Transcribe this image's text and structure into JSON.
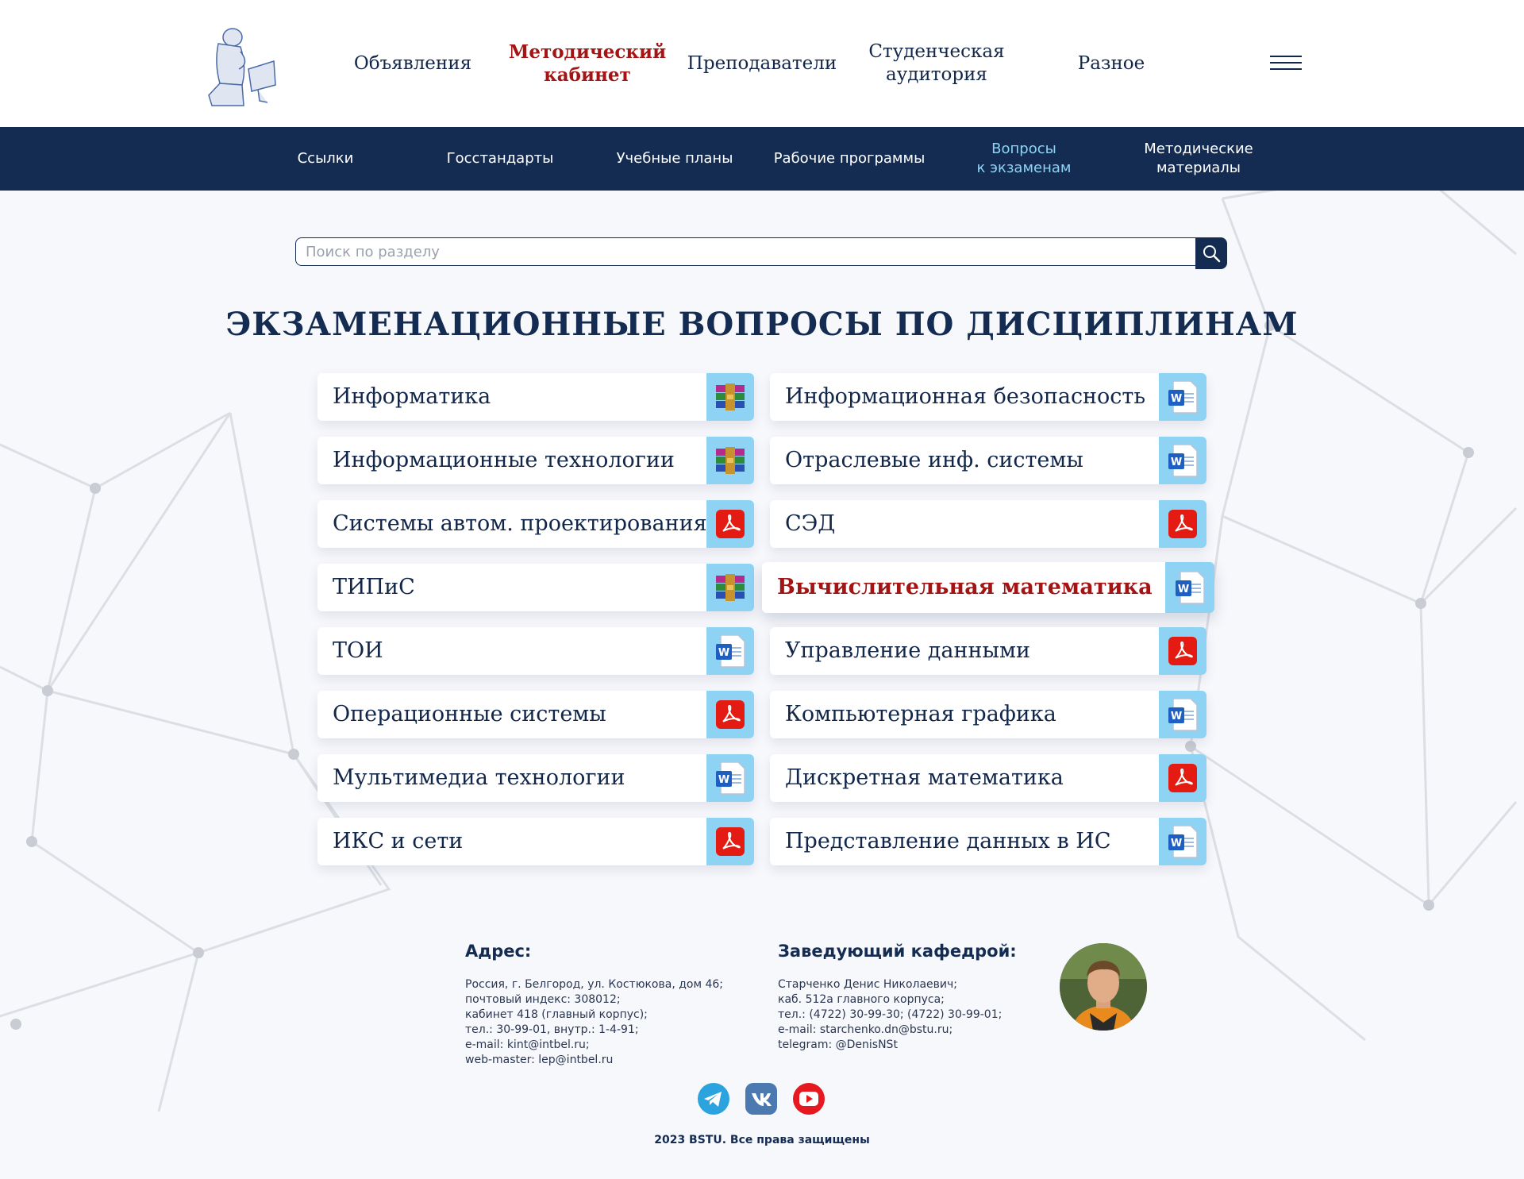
{
  "nav": {
    "items": [
      {
        "label": "Объявления"
      },
      {
        "label": "Методический\nкабинет"
      },
      {
        "label": "Преподаватели"
      },
      {
        "label": "Студенческая\nаудитория"
      },
      {
        "label": "Разное"
      }
    ],
    "active_index": 1,
    "menu_icon": "hamburger-icon",
    "logo_icon": "thinker-logo"
  },
  "subnav": {
    "items": [
      {
        "label": "Ссылки"
      },
      {
        "label": "Госстандарты"
      },
      {
        "label": "Учебные планы"
      },
      {
        "label": "Рабочие программы"
      },
      {
        "label": "Вопросы\nк экзаменам"
      },
      {
        "label": "Методические\nматериалы"
      }
    ],
    "active_index": 4
  },
  "search": {
    "placeholder": "Поиск по разделу",
    "value": "",
    "button_icon": "search-icon"
  },
  "page_title": "ЭКЗАМЕНАЦИОННЫЕ ВОПРОСЫ ПО ДИСЦИПЛИНАМ",
  "disciplines": {
    "left": [
      {
        "name": "Информатика",
        "file_icon": "archive-icon"
      },
      {
        "name": "Информационные технологии",
        "file_icon": "archive-icon"
      },
      {
        "name": "Системы автом. проектирования",
        "file_icon": "pdf-icon"
      },
      {
        "name": "ТИПиС",
        "file_icon": "archive-icon"
      },
      {
        "name": "ТОИ",
        "file_icon": "word-icon"
      },
      {
        "name": "Операционные системы",
        "file_icon": "pdf-icon"
      },
      {
        "name": "Мультимедиа технологии",
        "file_icon": "word-icon"
      },
      {
        "name": "ИКС и сети",
        "file_icon": "pdf-icon"
      }
    ],
    "right": [
      {
        "name": "Информационная безопасность",
        "file_icon": "word-icon"
      },
      {
        "name": "Отраслевые инф. системы",
        "file_icon": "word-icon"
      },
      {
        "name": "СЭД",
        "file_icon": "pdf-icon"
      },
      {
        "name": "Вычислительная математика",
        "file_icon": "word-icon",
        "highlighted": true
      },
      {
        "name": "Управление данными",
        "file_icon": "pdf-icon"
      },
      {
        "name": "Компьютерная графика",
        "file_icon": "word-icon"
      },
      {
        "name": "Дискретная математика",
        "file_icon": "pdf-icon"
      },
      {
        "name": "Представление данных в ИС",
        "file_icon": "word-icon"
      }
    ]
  },
  "footer": {
    "address": {
      "heading": "Адрес:",
      "lines": [
        "Россия, г. Белгород, ул. Костюкова, дом 46;",
        "почтовый индекс: 308012;",
        "кабинет 418 (главный корпус);",
        "тел.: 30-99-01, внутр.: 1-4-91;",
        "e-mail: kint@intbel.ru;",
        "web-master: lep@intbel.ru"
      ]
    },
    "head_of_dept": {
      "heading": "Заведующий кафедрой:",
      "lines": [
        "Старченко Денис Николаевич;",
        "каб. 512а главного корпуса;",
        "тел.: (4722) 30-99-30; (4722) 30-99-01;",
        "e-mail: starchenko.dn@bstu.ru;",
        "telegram: @DenisNSt"
      ],
      "photo": "head-of-department-photo"
    },
    "social": [
      "telegram-icon",
      "vk-icon",
      "youtube-icon"
    ],
    "copyright": "2023 BSTU. Все права защищены"
  },
  "colors": {
    "navy": "#142c52",
    "accent_red": "#a31414",
    "icon_bg": "#8fd3f4",
    "active_sub": "#8fd3f4"
  }
}
